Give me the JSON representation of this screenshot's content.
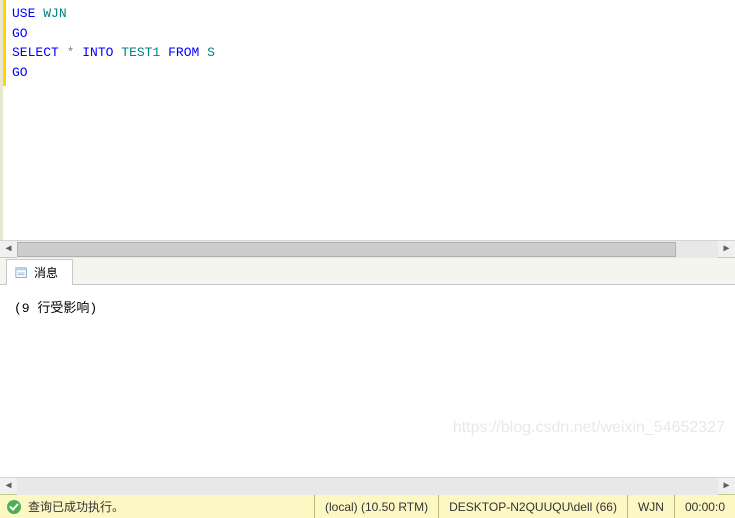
{
  "editor": {
    "tokens": [
      [
        {
          "t": "USE",
          "c": "kw"
        },
        {
          "t": " "
        },
        {
          "t": "WJN",
          "c": "ident"
        }
      ],
      [
        {
          "t": "GO",
          "c": "kw"
        }
      ],
      [
        {
          "t": "SELECT",
          "c": "kw"
        },
        {
          "t": " "
        },
        {
          "t": "*",
          "c": "op"
        },
        {
          "t": " "
        },
        {
          "t": "INTO",
          "c": "kw"
        },
        {
          "t": " "
        },
        {
          "t": "TEST1",
          "c": "ident"
        },
        {
          "t": " "
        },
        {
          "t": "FROM",
          "c": "kw"
        },
        {
          "t": " "
        },
        {
          "t": "S",
          "c": "ident"
        }
      ],
      [
        {
          "t": "GO",
          "c": "kw"
        }
      ]
    ]
  },
  "tab": {
    "label": "消息"
  },
  "messages": {
    "rows_affected": "(9 行受影响)"
  },
  "status": {
    "msg": "查询已成功执行。",
    "server": "(local) (10.50 RTM)",
    "user": "DESKTOP-N2QUUQU\\dell (66)",
    "db": "WJN",
    "time": "00:00:0"
  },
  "watermark": "https://blog.csdn.net/weixin_54652327"
}
